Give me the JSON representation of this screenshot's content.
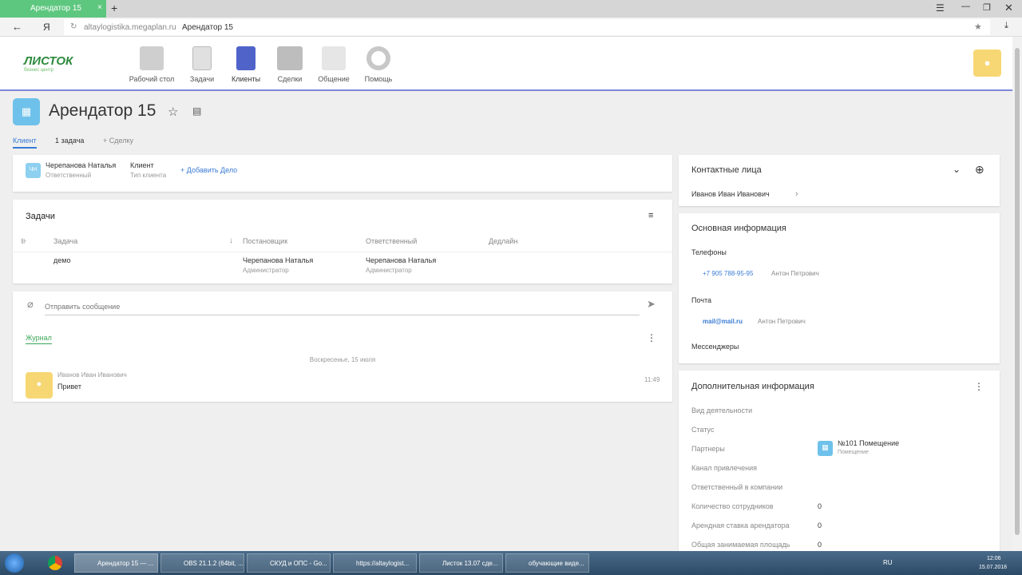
{
  "browser": {
    "tab_title": "Арендатор 15",
    "url": "altaylogistika.megaplan.ru",
    "page_title": "Арендатор 15",
    "yandex": "Я"
  },
  "logo": {
    "name": "ЛИСТОК",
    "sub": "бизнес центр"
  },
  "nav": [
    {
      "label": "Рабочий стол"
    },
    {
      "label": "Задачи"
    },
    {
      "label": "Клиенты"
    },
    {
      "label": "Сделки"
    },
    {
      "label": "Общение"
    },
    {
      "label": "Помощь"
    }
  ],
  "page": {
    "title": "Арендатор 15",
    "tabs": [
      "Клиент",
      "1 задача",
      "+ Сделку"
    ]
  },
  "summary": {
    "initials": "ЧН",
    "responsible_name": "Черепанова Наталья",
    "responsible_label": "Ответственный",
    "type_value": "Клиент",
    "type_label": "Тип клиента",
    "add_action": "+ Добавить Дело"
  },
  "tasks": {
    "title": "Задачи",
    "columns": [
      "Задача",
      "Постановщик",
      "Ответственный",
      "Дедлайн"
    ],
    "rows": [
      {
        "task": "демо",
        "author": "Черепанова Наталья",
        "author_role": "Администратор",
        "resp": "Черепанова Наталья",
        "resp_role": "Администратор",
        "deadline": ""
      }
    ]
  },
  "message": {
    "placeholder": "Отправить сообщение"
  },
  "journal": {
    "tab": "Журнал",
    "date": "Воскресенье, 15 июля",
    "entries": [
      {
        "author": "Иванов Иван Иванович",
        "text": "Привет",
        "time": "11:49"
      }
    ]
  },
  "contacts": {
    "title": "Контактные лица",
    "items": [
      "Иванов Иван Иванович"
    ]
  },
  "main_info": {
    "title": "Основная информация",
    "phones_label": "Телефоны",
    "phone": "+7 905 788-95-95",
    "phone_owner": "Антон Петрович",
    "mail_label": "Почта",
    "mail": "mail@mail.ru",
    "mail_owner": "Антон Петрович",
    "messengers_label": "Мессенджеры"
  },
  "extra": {
    "title": "Дополнительная информация",
    "fields": [
      {
        "label": "Вид деятельности",
        "value": ""
      },
      {
        "label": "Статус",
        "value": ""
      },
      {
        "label": "Партнеры",
        "value": "№101 Помещение",
        "sub": "Помещение"
      },
      {
        "label": "Канал привлечения",
        "value": ""
      },
      {
        "label": "Ответственный в компании",
        "value": ""
      },
      {
        "label": "Количество сотрудников",
        "value": "0"
      },
      {
        "label": "Арендная ставка арендатора",
        "value": "0"
      },
      {
        "label": "Общая занимаемая площадь",
        "value": "0"
      }
    ]
  },
  "taskbar": {
    "items": [
      "Арендатор 15 — ...",
      "OBS 21.1.2 (64bit, ...",
      "СКУД и ОПС - Go...",
      "https://altaylogist...",
      "Листок 13.07 сде...",
      "обучающие виде..."
    ],
    "lang": "RU",
    "time": "12:06",
    "date": "15.07.2018"
  },
  "colors": {
    "accent": "#3a7bd5",
    "green": "#5ec77f",
    "nav_line": "#7b86d9"
  }
}
